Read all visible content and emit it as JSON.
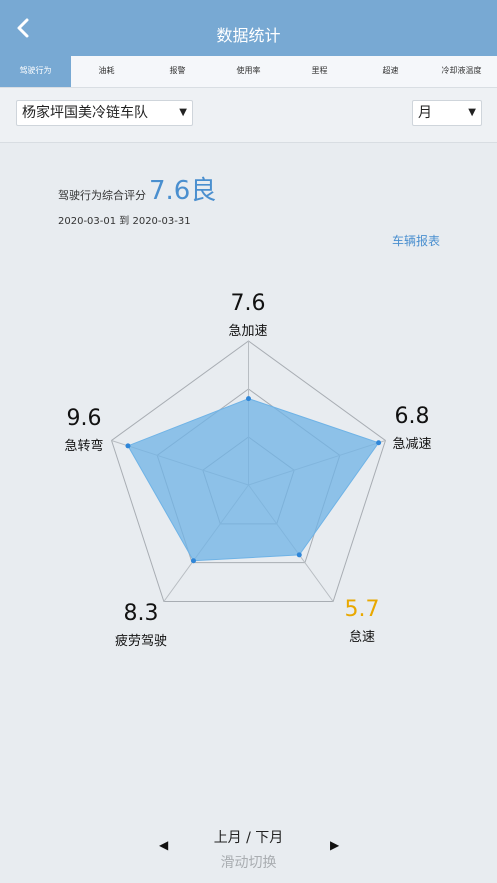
{
  "header": {
    "title": "数据统计"
  },
  "tabs": [
    {
      "label": "驾驶行为"
    },
    {
      "label": "油耗"
    },
    {
      "label": "报警"
    },
    {
      "label": "使用率"
    },
    {
      "label": "里程"
    },
    {
      "label": "超速"
    },
    {
      "label": "冷却液温度"
    }
  ],
  "filters": {
    "fleet": "杨家坪国美冷链车队",
    "period": "月"
  },
  "summary": {
    "label": "驾驶行为综合评分",
    "score": "7.6良",
    "date_range": "2020-03-01 到 2020-03-31",
    "report_link": "车辆报表"
  },
  "chart_data": {
    "type": "radar",
    "axes": [
      {
        "label": "急加速",
        "value": 7.6,
        "display": "7.6"
      },
      {
        "label": "急减速",
        "value": 6.8,
        "display": "6.8"
      },
      {
        "label": "怠速",
        "value": 5.7,
        "display": "5.7"
      },
      {
        "label": "疲劳驾驶",
        "value": 8.3,
        "display": "8.3"
      },
      {
        "label": "急转弯",
        "value": 9.6,
        "display": "9.6"
      }
    ],
    "series_values": [
      6.0,
      9.5,
      6.0,
      6.5,
      8.8
    ],
    "max": 10,
    "levels": 3,
    "colors": {
      "fill": "#6fb3e6",
      "point": "#2f86d8",
      "warning": "#e9a800"
    }
  },
  "pager": {
    "main": "上月 / 下月",
    "hint": "滑动切换",
    "prev_icon": "left-triangle-icon",
    "next_icon": "right-triangle-icon"
  }
}
